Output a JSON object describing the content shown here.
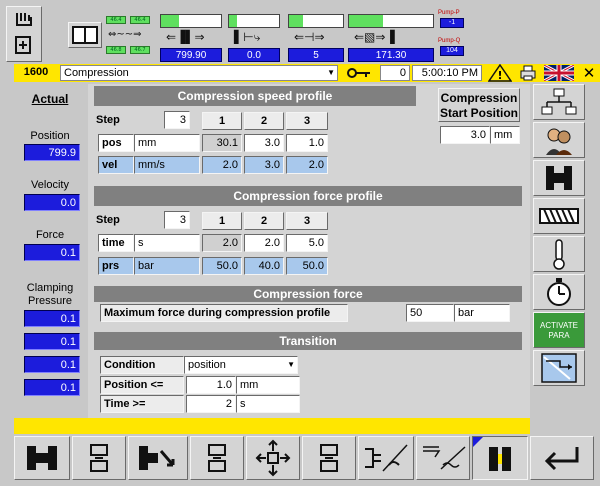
{
  "topbar": {
    "leds_left": [
      "46.4",
      "46.4",
      "46.8",
      "46.7"
    ],
    "values": [
      "799.90",
      "0.0",
      "5",
      "171.30"
    ],
    "pump_p_label": "Pump-P",
    "pump_p_value": "-1",
    "pump_q_label": "Pump-Q",
    "pump_q_value": "104"
  },
  "status": {
    "program_number": "1600",
    "program_name": "Compression",
    "counter": "0",
    "time": "5:00:10 PM"
  },
  "actual": {
    "title": "Actual",
    "position_label": "Position",
    "position_value": "799.9",
    "velocity_label": "Velocity",
    "velocity_value": "0.0",
    "force_label": "Force",
    "force_value": "0.1",
    "clamping_label": "Clamping Pressure",
    "clamping_values": [
      "0.1",
      "0.1",
      "0.1",
      "0.1"
    ]
  },
  "speed_profile": {
    "title": "Compression speed profile",
    "step_label": "Step",
    "step_value": "3",
    "columns": [
      "1",
      "2",
      "3"
    ],
    "rows": [
      {
        "label": "pos",
        "unit": "mm",
        "values": [
          "30.1",
          "3.0",
          "1.0"
        ]
      },
      {
        "label": "vel",
        "unit": "mm/s",
        "values": [
          "2.0",
          "3.0",
          "2.0"
        ]
      }
    ]
  },
  "start_position": {
    "title_line1": "Compression",
    "title_line2": "Start Position",
    "value": "3.0",
    "unit": "mm"
  },
  "force_profile": {
    "title": "Compression force profile",
    "step_label": "Step",
    "step_value": "3",
    "columns": [
      "1",
      "2",
      "3"
    ],
    "rows": [
      {
        "label": "time",
        "unit": "s",
        "values": [
          "2.0",
          "2.0",
          "5.0"
        ]
      },
      {
        "label": "prs",
        "unit": "bar",
        "values": [
          "50.0",
          "40.0",
          "50.0"
        ]
      }
    ]
  },
  "compression_force": {
    "title": "Compression force",
    "label": "Maximum force during compression profile",
    "value": "50",
    "unit": "bar"
  },
  "transition": {
    "title": "Transition",
    "condition_label": "Condition",
    "condition_value": "position",
    "position_label": "Position <=",
    "position_value": "1.0",
    "position_unit": "mm",
    "time_label": "Time >=",
    "time_value": "2",
    "time_unit": "s"
  },
  "right_panel": {
    "activate_label": "ACTIVATE PARA"
  },
  "colors": {
    "accent_blue": "#1c1cdc",
    "status_yellow": "#ffe600",
    "header_gray": "#808080",
    "cell_blue": "#a8c8ec",
    "activate_green": "#3a9a3a"
  }
}
